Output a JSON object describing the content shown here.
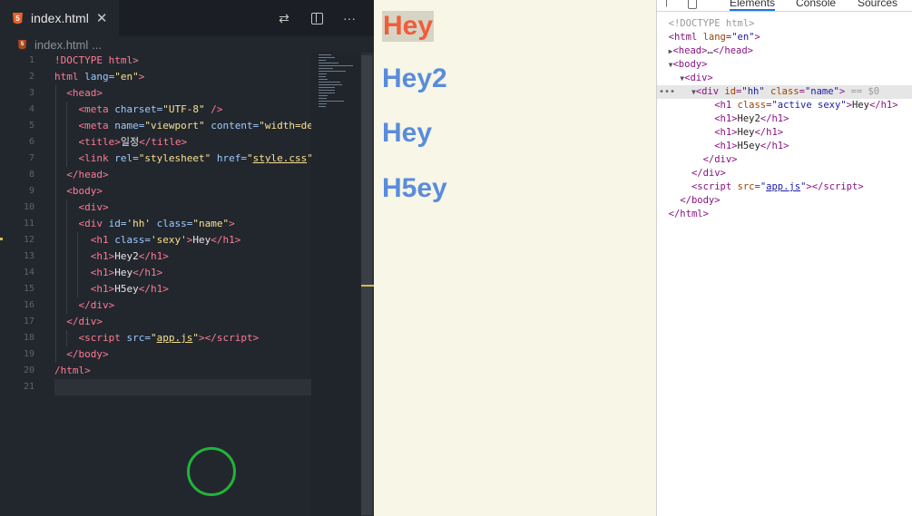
{
  "editor": {
    "tab_label": "index.html",
    "breadcrumb": [
      "index.html",
      "..."
    ],
    "lines": [
      {
        "n": "1"
      },
      {
        "n": "2"
      },
      {
        "n": "3"
      },
      {
        "n": "4"
      },
      {
        "n": "5"
      },
      {
        "n": "6"
      },
      {
        "n": "7"
      },
      {
        "n": "8"
      },
      {
        "n": "9"
      },
      {
        "n": "10"
      },
      {
        "n": "11"
      },
      {
        "n": "12"
      },
      {
        "n": "13"
      },
      {
        "n": "14"
      },
      {
        "n": "15"
      },
      {
        "n": "16"
      },
      {
        "n": "17"
      },
      {
        "n": "18"
      },
      {
        "n": "19"
      },
      {
        "n": "20"
      },
      {
        "n": "21"
      }
    ],
    "code": {
      "l1": "!DOCTYPE html>",
      "l2_tag": "html",
      "l2_attr": " lang=",
      "l2_val": "\"en\"",
      "l6_title": "일정",
      "l7_href": "style.css",
      "l12_val": "'sexy'",
      "l12_text": "Hey",
      "l13_text": "Hey2",
      "l14_text": "Hey",
      "l15_text": "H5ey",
      "l18_src": "app.js"
    }
  },
  "preview": {
    "headings": [
      "Hey",
      "Hey2",
      "Hey",
      "H5ey"
    ]
  },
  "devtools": {
    "tabs": [
      "Elements",
      "Console",
      "Sources"
    ],
    "selected_tab": "Elements",
    "doctype": "<!DOCTYPE html>",
    "selected_suffix": " == $0",
    "h1_texts": [
      "Hey",
      "Hey2",
      "Hey",
      "H5ey"
    ],
    "script_src": "app.js"
  },
  "colors": {
    "active_heading": "#f25c3b",
    "heading": "#5a8cdb",
    "preview_bg": "#f7f6e7",
    "loader": "#22b33a"
  }
}
